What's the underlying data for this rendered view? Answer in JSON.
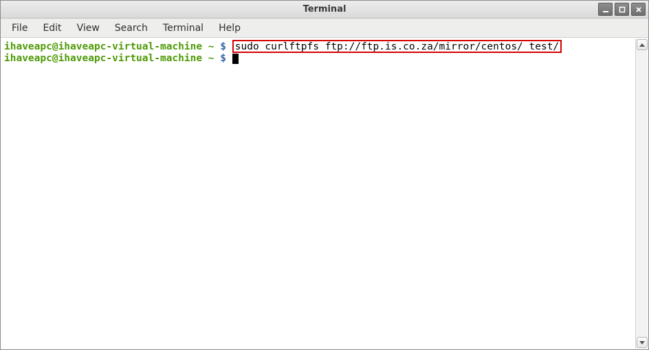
{
  "window": {
    "title": "Terminal"
  },
  "menubar": {
    "items": [
      "File",
      "Edit",
      "View",
      "Search",
      "Terminal",
      "Help"
    ]
  },
  "terminal": {
    "lines": [
      {
        "prompt": "ihaveapc@ihaveapc-virtual-machine ~ ",
        "dollar": "$ ",
        "command": "sudo curlftpfs ftp://ftp.is.co.za/mirror/centos/ test/",
        "highlighted": true
      },
      {
        "prompt": "ihaveapc@ihaveapc-virtual-machine ~ ",
        "dollar": "$ ",
        "command": "",
        "cursor": true
      }
    ]
  },
  "icons": {
    "minimize": "minimize-icon",
    "maximize": "maximize-icon",
    "close": "close-icon",
    "scroll_up": "chevron-up-icon",
    "scroll_down": "chevron-down-icon"
  }
}
